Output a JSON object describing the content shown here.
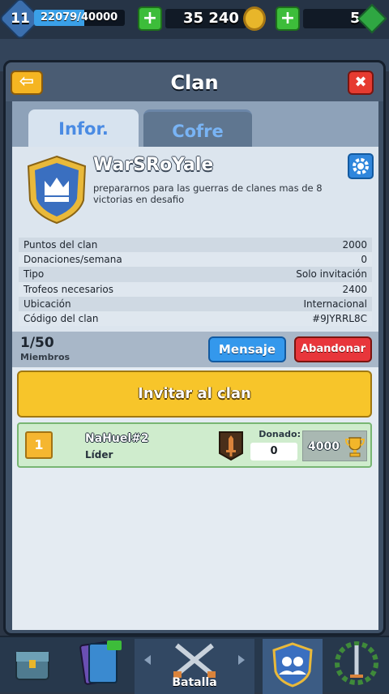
{
  "hud": {
    "level": "11",
    "xp": "22079/40000",
    "xp_fraction": 0.552,
    "gold": "35 240",
    "gems": "5"
  },
  "dialog": {
    "title": "Clan",
    "tabs": [
      {
        "label": "Infor."
      },
      {
        "label": "Cofre"
      }
    ]
  },
  "clan": {
    "name": "WarSRoYale",
    "description": "prepararnos para las guerras de clanes mas de 8 victorias en desafio",
    "stats": [
      {
        "label": "Puntos del clan",
        "value": "2000"
      },
      {
        "label": "Donaciones/semana",
        "value": "0"
      },
      {
        "label": "Tipo",
        "value": "Solo invitación"
      },
      {
        "label": "Trofeos necesarios",
        "value": "2400"
      },
      {
        "label": "Ubicación",
        "value": "Internacional"
      },
      {
        "label": "Código del clan",
        "value": "#9JYRRL8C"
      }
    ]
  },
  "members": {
    "count": "1/50",
    "label": "Miembros",
    "message_label": "Mensaje",
    "leave_label": "Abandonar",
    "invite_label": "Invitar al clan",
    "list": [
      {
        "rank": "1",
        "name": "NaHuel#2",
        "role": "Líder",
        "donated_label": "Donado:",
        "donated": "0",
        "trophies": "4000"
      }
    ]
  },
  "nav": {
    "battle_label": "Batalla"
  },
  "colors": {
    "accent_blue": "#3498ec",
    "danger_red": "#e8363b",
    "invite_yellow": "#f7c52a",
    "member_green": "#cfeccd"
  }
}
